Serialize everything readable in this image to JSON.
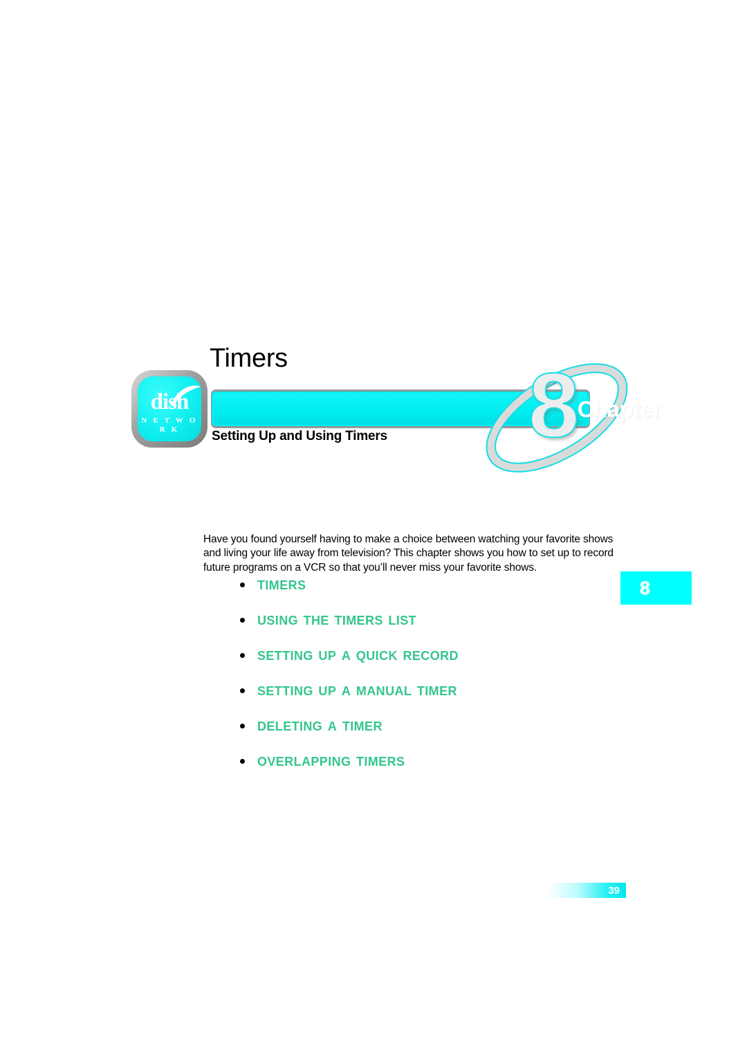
{
  "document": {
    "chapter_title": "Timers",
    "chapter_label": "Chapter",
    "chapter_number": "8",
    "chapter_subtitle": "Setting Up and Using Timers",
    "page_number": "39"
  },
  "logo": {
    "wordmark": "dish",
    "subtext": "N E T W O R K",
    "dish_arc_icon": "satellite-dish-arc-icon"
  },
  "intro": {
    "paragraph": "Have you found yourself having to make a choice between watching your favorite shows and living your life away from television? This chapter shows you how to set up to record future programs on a VCR so that you’ll never miss your favorite shows."
  },
  "topics": [
    {
      "label": "Timers"
    },
    {
      "label": "Using the Timers List"
    },
    {
      "label": "Setting Up a Quick Record"
    },
    {
      "label": "Setting Up a Manual Timer"
    },
    {
      "label": "Deleting a Timer"
    },
    {
      "label": "Overlapping Timers"
    }
  ],
  "side_tab": {
    "number": "8"
  },
  "colors": {
    "banner_cyan": "#00f0f2",
    "tab_cyan": "#00ffff",
    "topic_green": "#34c68c",
    "number_outline": "#16dfe4",
    "number_fill": "#eceded",
    "text_black": "#000000"
  }
}
